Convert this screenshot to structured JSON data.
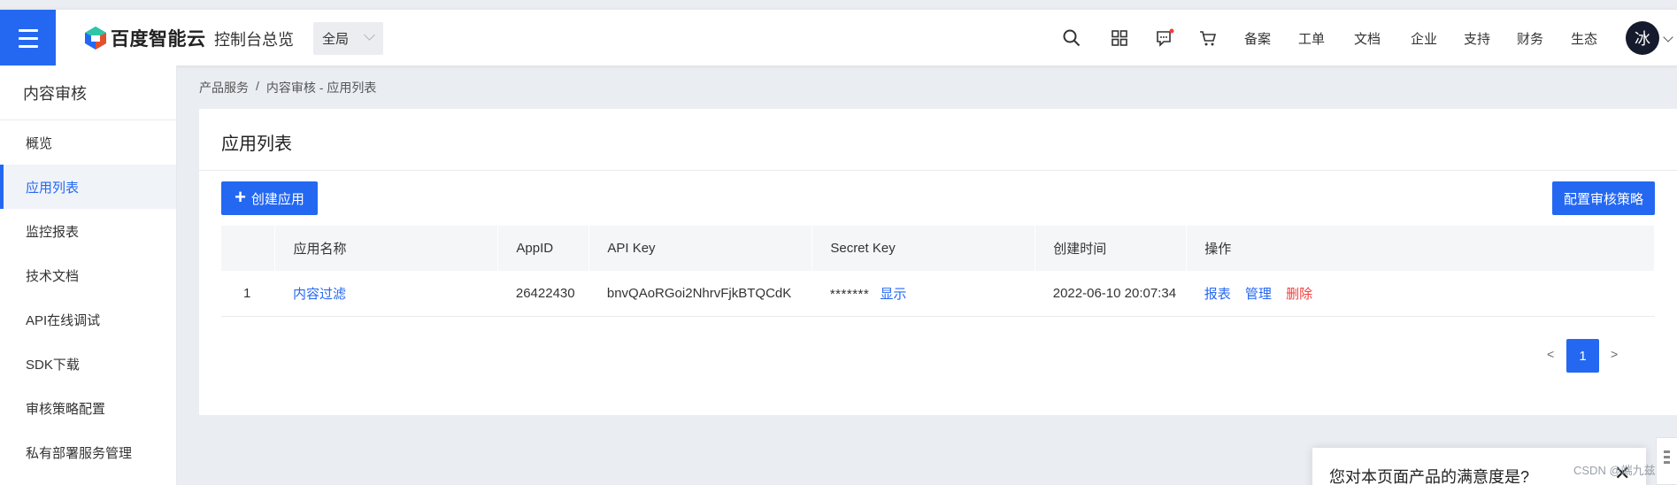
{
  "header": {
    "brand": "百度智能云",
    "console_home": "控制台总览",
    "region": "全局",
    "nav": [
      "备案",
      "工单",
      "文档",
      "企业",
      "支持",
      "财务",
      "生态"
    ],
    "avatar_text": "冰",
    "icons": [
      "search-icon",
      "app-grid-icon",
      "message-icon",
      "cart-icon"
    ],
    "accent": "#2468f2"
  },
  "sidebar": {
    "title": "内容审核",
    "items": [
      {
        "label": "概览",
        "active": false
      },
      {
        "label": "应用列表",
        "active": true
      },
      {
        "label": "监控报表",
        "active": false
      },
      {
        "label": "技术文档",
        "active": false
      },
      {
        "label": "API在线调试",
        "active": false
      },
      {
        "label": "SDK下载",
        "active": false
      },
      {
        "label": "审核策略配置",
        "active": false
      },
      {
        "label": "私有部署服务管理",
        "active": false
      }
    ]
  },
  "breadcrumb": [
    "产品服务",
    "内容审核 - 应用列表"
  ],
  "breadcrumb_separator": "/",
  "main": {
    "title": "应用列表",
    "create_button": "创建应用",
    "create_icon": "+",
    "policy_button": "配置审核策略",
    "columns": [
      "",
      "应用名称",
      "AppID",
      "API Key",
      "Secret Key",
      "创建时间",
      "操作"
    ],
    "rows": [
      {
        "index": "1",
        "name": "内容过滤",
        "app_id": "26422430",
        "api_key": "bnvQAoRGoi2NhrvFjkBTQCdK",
        "secret_masked": "*******",
        "secret_show": "显示",
        "created": "2022-06-10 20:07:34",
        "actions": {
          "report": "报表",
          "manage": "管理",
          "delete": "删除"
        }
      }
    ],
    "pagination": {
      "prev": "<",
      "current": "1",
      "next": ">"
    }
  },
  "survey": {
    "question": "您对本页面产品的满意度是?",
    "close": "✕"
  },
  "watermark": "CSDN @端九兹"
}
